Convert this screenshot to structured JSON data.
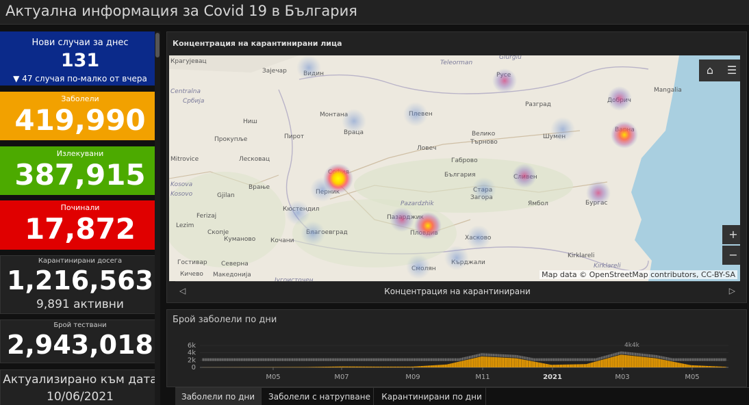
{
  "page": {
    "title": "Актуална информация за Covid 19 в България"
  },
  "cards": {
    "new_cases": {
      "label": "Нови случаи за днес",
      "value": "131",
      "change": "▼ 47 случая по-малко от вчера"
    },
    "infected": {
      "label": "Заболели",
      "value": "419,990"
    },
    "recovered": {
      "label": "Излекувани",
      "value": "387,915"
    },
    "deaths": {
      "label": "Починали",
      "value": "17,872"
    },
    "quarantined": {
      "label": "Карантинирани досега",
      "value": "1,216,563",
      "active": "9,891 активни"
    },
    "tests": {
      "label": "Брой тествани",
      "value": "2,943,018"
    },
    "updated": {
      "label": "Актуализирано към дата",
      "date": "10/06/2021"
    }
  },
  "map_panel": {
    "title": "Концентрация на карантинирани лица",
    "attribution": "Map data © OpenStreetMap contributors, CC-BY-SA",
    "carousel_label": "Концентрация на карантинирани",
    "tools": {
      "home": "home-icon",
      "legend": "list-icon",
      "zoom_in": "+",
      "zoom_out": "−"
    },
    "places": [
      "Крагујевац",
      "Зајечар",
      "Видин",
      "Giurgiu",
      "Teleorman",
      "Русе",
      "Centralna",
      "Србија",
      "Монтана",
      "Плевен",
      "Разград",
      "Добрич",
      "Mangalia",
      "Ниш",
      "Враца",
      "Велико",
      "Търново",
      "Шумен",
      "Варна",
      "Пирот",
      "Ловеч",
      "Прокупље",
      "Mitrovice",
      "Лесковац",
      "Габрово",
      "София",
      "България",
      "Сливен",
      "Kosova",
      "Kosovo",
      "Врање",
      "Перник",
      "Стара",
      "Загора",
      "Ямбол",
      "Бургас",
      "Gjilan",
      "Кюстендил",
      "Ferizaj",
      "Pazardzhik",
      "Пазарджик",
      "Lezim",
      "Скопје",
      "Благоевград",
      "Пловдив",
      "Хасково",
      "Кочани",
      "Куманово",
      "Kirklareli",
      "Гостивар",
      "Северна",
      "Смолян",
      "Кърджали",
      "Кичево",
      "Македонија",
      "Југоисточен",
      "Kırklareli"
    ],
    "hotspots": [
      {
        "name": "София",
        "intensity": 1.0
      },
      {
        "name": "Пловдив",
        "intensity": 0.85
      },
      {
        "name": "Варна",
        "intensity": 0.8
      },
      {
        "name": "Бургас",
        "intensity": 0.45
      },
      {
        "name": "Русе",
        "intensity": 0.4
      },
      {
        "name": "Добрич",
        "intensity": 0.35
      },
      {
        "name": "Пазарджик",
        "intensity": 0.35
      },
      {
        "name": "Сливен",
        "intensity": 0.3
      },
      {
        "name": "Видин",
        "intensity": 0.2
      },
      {
        "name": "Плевен",
        "intensity": 0.2
      },
      {
        "name": "Шумен",
        "intensity": 0.2
      },
      {
        "name": "Перник",
        "intensity": 0.2
      },
      {
        "name": "Хасково",
        "intensity": 0.2
      },
      {
        "name": "Смолян",
        "intensity": 0.15
      },
      {
        "name": "Кърджали",
        "intensity": 0.15
      },
      {
        "name": "Благоевград",
        "intensity": 0.15
      },
      {
        "name": "Кюстендил",
        "intensity": 0.15
      },
      {
        "name": "Стара Загора",
        "intensity": 0.15
      },
      {
        "name": "Враца",
        "intensity": 0.15
      }
    ]
  },
  "chart_panel": {
    "title": "Брой заболели по дни"
  },
  "chart_data": {
    "type": "bar",
    "title": "Брой заболели по дни",
    "xlabel": "",
    "ylabel": "",
    "ylim": [
      0,
      6000
    ],
    "yticks": [
      "0",
      "2k",
      "4k",
      "6k"
    ],
    "xticks": [
      "M05",
      "M07",
      "M09",
      "M11",
      "2021",
      "M03",
      "M05"
    ],
    "annotation": "4k4k",
    "series": [
      {
        "points": [
          [
            "2020-03",
            20
          ],
          [
            "2020-04",
            40
          ],
          [
            "2020-05",
            60
          ],
          [
            "2020-06",
            100
          ],
          [
            "2020-07",
            250
          ],
          [
            "2020-08",
            200
          ],
          [
            "2020-09",
            200
          ],
          [
            "2020-10",
            800
          ],
          [
            "2020-11",
            3000
          ],
          [
            "2020-12",
            2500
          ],
          [
            "2021-01",
            700
          ],
          [
            "2021-02",
            900
          ],
          [
            "2021-03",
            3500
          ],
          [
            "2021-04",
            2500
          ],
          [
            "2021-05",
            600
          ],
          [
            "2021-06",
            150
          ]
        ]
      }
    ],
    "colors": {
      "bars": "#f2a100",
      "overlay": "#aaaaaa"
    }
  },
  "tabs": [
    {
      "label": "Заболели по дни",
      "active": true
    },
    {
      "label": "Заболели с натрупване",
      "active": false
    },
    {
      "label": "Карантинирани по дни",
      "active": false
    }
  ]
}
